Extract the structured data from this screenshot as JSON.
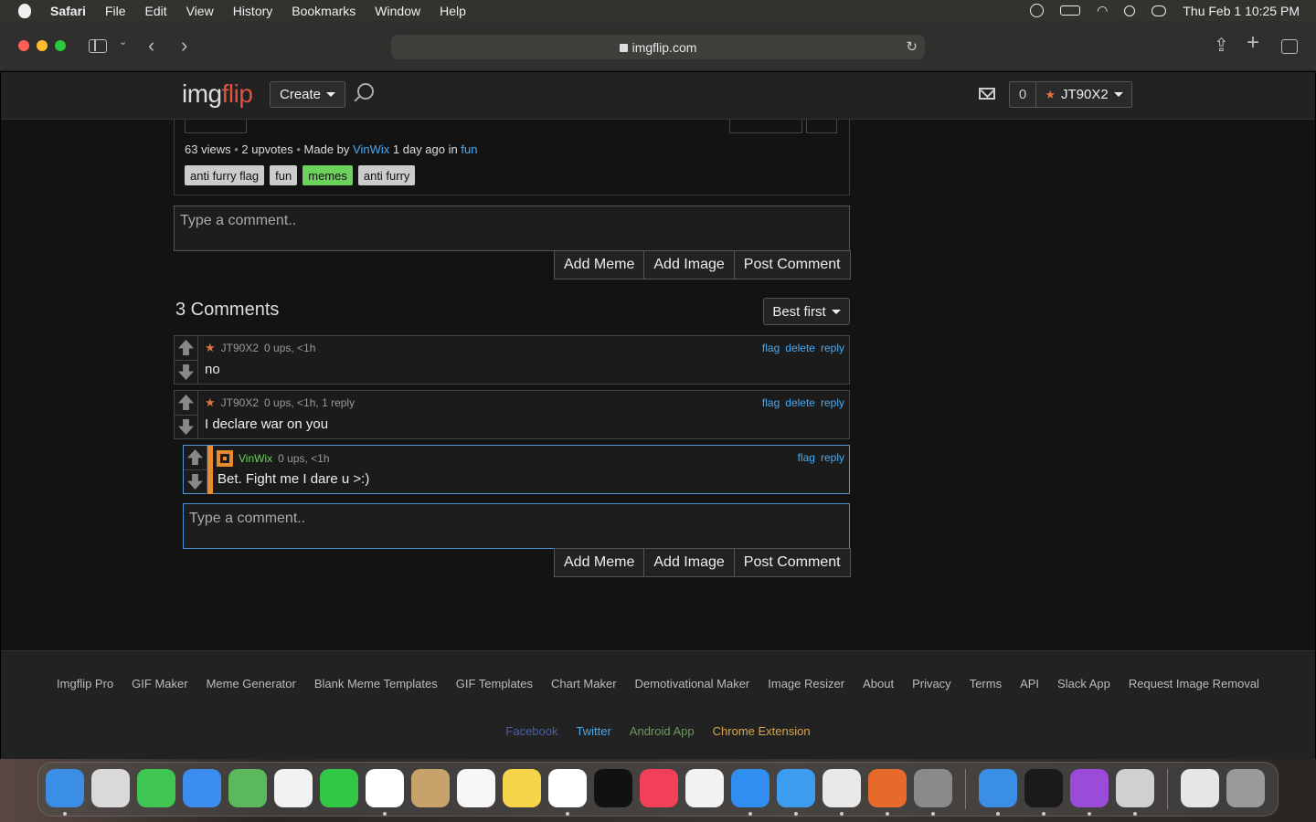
{
  "menubar": {
    "app_name": "Safari",
    "menus": [
      "File",
      "Edit",
      "View",
      "History",
      "Bookmarks",
      "Window",
      "Help"
    ],
    "datetime": "Thu Feb 1  10:25 PM"
  },
  "browser": {
    "url": "imgflip.com"
  },
  "site": {
    "logo_img": "img",
    "logo_flip": "flip",
    "create_label": "Create",
    "points": "0",
    "username": "JT90X2"
  },
  "post": {
    "views": "63 views",
    "upvotes": "2 upvotes",
    "made_by": "Made by",
    "author": "VinWix",
    "age": "1 day ago in",
    "stream": "fun",
    "tags": [
      {
        "label": "anti furry flag",
        "active": false
      },
      {
        "label": "fun",
        "active": false
      },
      {
        "label": "memes",
        "active": true
      },
      {
        "label": "anti furry",
        "active": false
      }
    ]
  },
  "comment_form": {
    "placeholder": "Type a comment..",
    "add_meme": "Add Meme",
    "add_image": "Add Image",
    "post_comment": "Post Comment"
  },
  "comments_section": {
    "title": "3 Comments",
    "sort_label": "Best first",
    "comments": [
      {
        "user": "JT90X2",
        "meta": "0 ups, <1h",
        "text": "no",
        "actions": [
          "flag",
          "delete",
          "reply"
        ]
      },
      {
        "user": "JT90X2",
        "meta": "0 ups, <1h, 1 reply",
        "text": "I declare war on you",
        "actions": [
          "flag",
          "delete",
          "reply"
        ]
      },
      {
        "user": "VinWix",
        "meta": "0 ups, <1h",
        "text": "Bet. Fight me I dare u >:)",
        "actions": [
          "flag",
          "reply"
        ]
      }
    ]
  },
  "reply_form": {
    "placeholder": "Type a comment..",
    "add_meme": "Add Meme",
    "add_image": "Add Image",
    "post_comment": "Post Comment"
  },
  "footer": {
    "links": [
      "Imgflip Pro",
      "GIF Maker",
      "Meme Generator",
      "Blank Meme Templates",
      "GIF Templates",
      "Chart Maker",
      "Demotivational Maker",
      "Image Resizer",
      "About",
      "Privacy",
      "Terms",
      "API",
      "Slack App",
      "Request Image Removal"
    ],
    "social": [
      {
        "label": "Facebook",
        "color": "#4a5fa0"
      },
      {
        "label": "Twitter",
        "color": "#49a9f1"
      },
      {
        "label": "Android App",
        "color": "#6d9a5d"
      },
      {
        "label": "Chrome Extension",
        "color": "#d9a548"
      }
    ]
  },
  "dock": {
    "items": [
      {
        "name": "finder-icon",
        "color": "#3a8ee6",
        "running": true
      },
      {
        "name": "launchpad-icon",
        "color": "#d9d9d9",
        "running": false
      },
      {
        "name": "messages-icon",
        "color": "#3ec552",
        "running": false
      },
      {
        "name": "mail-app-icon",
        "color": "#3b8ef0",
        "running": false
      },
      {
        "name": "maps-icon",
        "color": "#5cb85c",
        "running": false
      },
      {
        "name": "photos-icon",
        "color": "#f2f2f2",
        "running": false
      },
      {
        "name": "facetime-icon",
        "color": "#33c748",
        "running": false
      },
      {
        "name": "calendar-icon",
        "color": "#ffffff",
        "running": true
      },
      {
        "name": "contacts-icon",
        "color": "#c8a26b",
        "running": false
      },
      {
        "name": "reminders-icon",
        "color": "#f7f7f7",
        "running": false
      },
      {
        "name": "notes-icon",
        "color": "#f6d54a",
        "running": false
      },
      {
        "name": "freeform-icon",
        "color": "#ffffff",
        "running": true
      },
      {
        "name": "apple-tv-icon",
        "color": "#111111",
        "running": false
      },
      {
        "name": "music-icon",
        "color": "#f2405a",
        "running": false
      },
      {
        "name": "news-icon",
        "color": "#f2f2f2",
        "running": false
      },
      {
        "name": "app-store-icon",
        "color": "#2f8ef0",
        "running": true
      },
      {
        "name": "safari-icon",
        "color": "#3b9cf0",
        "running": true
      },
      {
        "name": "chrome-icon",
        "color": "#e9e9e9",
        "running": true
      },
      {
        "name": "firefox-icon",
        "color": "#e66a2a",
        "running": true
      },
      {
        "name": "system-settings-icon",
        "color": "#8a8a8a",
        "running": true
      }
    ],
    "items_right": [
      {
        "name": "xcode-tools-icon",
        "color": "#3a8ee6",
        "running": true
      },
      {
        "name": "terminal-icon",
        "color": "#1a1a1a",
        "running": true
      },
      {
        "name": "podcasts-icon",
        "color": "#9a4bd8",
        "running": true
      },
      {
        "name": "preview-icon",
        "color": "#d0d0d0",
        "running": true
      }
    ],
    "items_end": [
      {
        "name": "document-thumbnail-icon",
        "color": "#e6e6e6",
        "running": false
      },
      {
        "name": "trash-icon",
        "color": "#9a9a9a",
        "running": false
      }
    ]
  }
}
